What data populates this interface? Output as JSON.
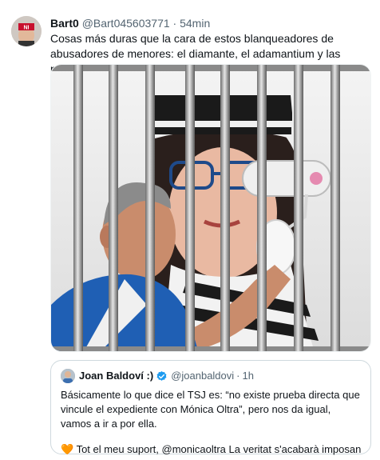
{
  "tweet": {
    "display_name": "Bart0",
    "handle": "@Bart045603771",
    "separator": "·",
    "time": "54min",
    "text": "Cosas más duras que la cara de estos blanqueadores de abusadores de menores: el diamante, el adamantium y las pelotas de Superman...",
    "avatar_badge": "NI"
  },
  "quoted": {
    "display_name": "Joan Baldoví :)",
    "handle": "@joanbaldovi",
    "separator": "·",
    "time": "1h",
    "text": "Básicamente lo que dice el TSJ es: “no existe prueba directa que vincule el expediente con Mónica Oltra”, pero nos da igual, vamos a ir a por ella.",
    "text2": "Tot el meu suport, @monicaoltra La veritat s'acabarà imposant! ...",
    "heart_icon": "🧡"
  },
  "colors": {
    "text": "#0f1419",
    "secondary": "#536471",
    "border": "#cfd9de",
    "verified": "#1d9bf0"
  }
}
